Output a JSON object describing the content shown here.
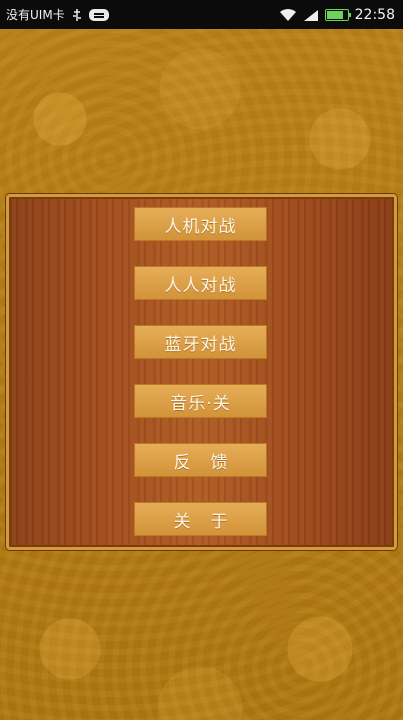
{
  "status_bar": {
    "carrier": "没有UIM卡",
    "time": "22:58",
    "icons": [
      "usb-icon",
      "message-icon",
      "wifi-icon",
      "signal-icon",
      "battery-icon"
    ]
  },
  "menu": {
    "items": [
      {
        "label": "人机对战"
      },
      {
        "label": "人人对战"
      },
      {
        "label": "蓝牙对战"
      },
      {
        "label": "音乐·关"
      },
      {
        "label": "反馈"
      },
      {
        "label": "关于"
      }
    ]
  },
  "colors": {
    "background": "#b07a14",
    "panel_wood": "#a34e1d",
    "button": "#e0a54f",
    "button_text": "#fbf5e6"
  }
}
